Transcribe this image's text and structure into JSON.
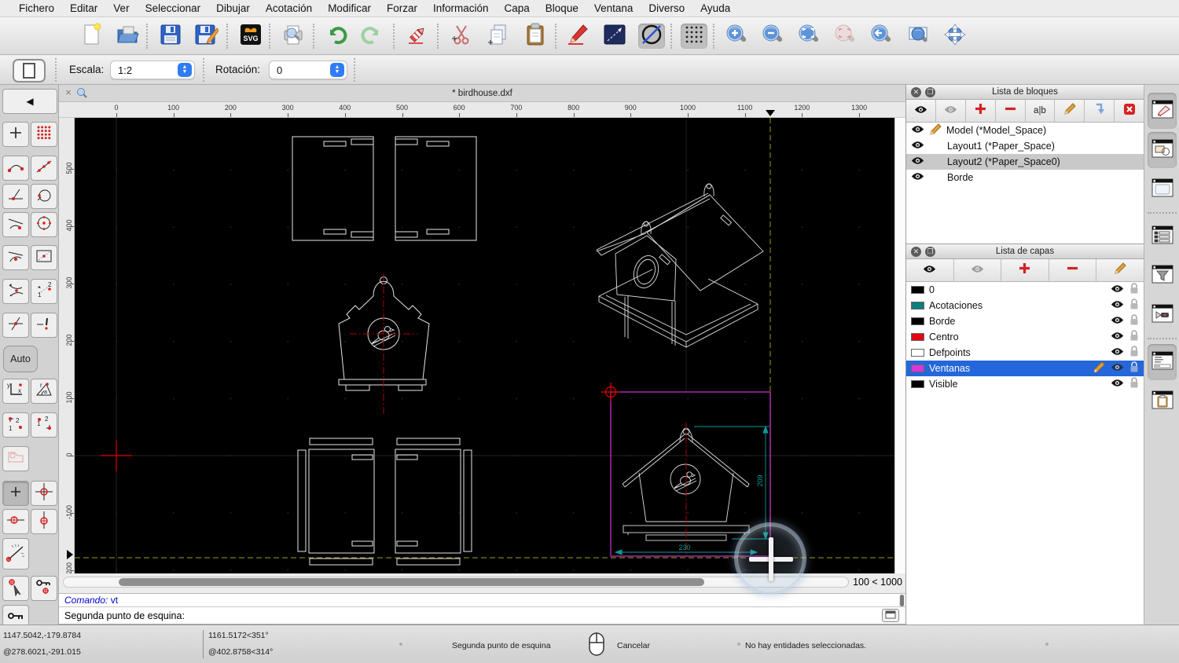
{
  "menu": {
    "items": [
      "Fichero",
      "Editar",
      "Ver",
      "Seleccionar",
      "Dibujar",
      "Acotación",
      "Modificar",
      "Forzar",
      "Información",
      "Capa",
      "Bloque",
      "Ventana",
      "Diverso",
      "Ayuda"
    ]
  },
  "toolbar2": {
    "scale_label": "Escala:",
    "scale_value": "1:2",
    "rotation_label": "Rotación:",
    "rotation_value": "0"
  },
  "document": {
    "tab_title": "* birdhouse.dxf",
    "close_glyph": "×"
  },
  "rulers": {
    "h_ticks": [
      "0",
      "100",
      "200",
      "300",
      "400",
      "500",
      "600",
      "700",
      "800",
      "900",
      "1000",
      "1100",
      "1200",
      "1300"
    ],
    "v_ticks": [
      "500",
      "400",
      "300",
      "200",
      "100",
      "0",
      "-100",
      "-200"
    ]
  },
  "canvas": {
    "zoom_status": "100 < 1000",
    "dim_height": "209",
    "dim_width": "230"
  },
  "palette": {
    "auto_label": "Auto"
  },
  "icons": {
    "svg_label": "SVG",
    "rename_label": "a|b",
    "coord_y": "y",
    "coord_x": "x",
    "coord_r": "r",
    "coord_a": "a",
    "num1": "1",
    "num2": "2"
  },
  "panels": {
    "blocks": {
      "title": "Lista de bloques",
      "items": [
        {
          "label": "Model (*Model_Space)"
        },
        {
          "label": "Layout1 (*Paper_Space)"
        },
        {
          "label": "Layout2 (*Paper_Space0)"
        },
        {
          "label": "Borde"
        }
      ]
    },
    "layers": {
      "title": "Lista de capas",
      "items": [
        {
          "label": "0",
          "color": "#000000"
        },
        {
          "label": "Acotaciones",
          "color": "#0e7d7d"
        },
        {
          "label": "Borde",
          "color": "#000000"
        },
        {
          "label": "Centro",
          "color": "#e30613"
        },
        {
          "label": "Defpoints",
          "color": "#ffffff"
        },
        {
          "label": "Ventanas",
          "color": "#d936d9"
        },
        {
          "label": "Visible",
          "color": "#000000"
        }
      ]
    }
  },
  "command": {
    "history_label": "Comando:",
    "history_value": "vt",
    "prompt_label": "Segunda punto de esquina:",
    "prompt_value": ""
  },
  "statusbar": {
    "abs_coord": "1147.5042,-179.8784",
    "rel_coord": "@278.6021,-291.015",
    "abs_polar": "1161.5172<351°",
    "rel_polar": "@402.8758<314°",
    "mouse_left": "Segunda punto de esquina",
    "mouse_right": "Cancelar",
    "selection_status": "No hay entidades seleccionadas."
  }
}
